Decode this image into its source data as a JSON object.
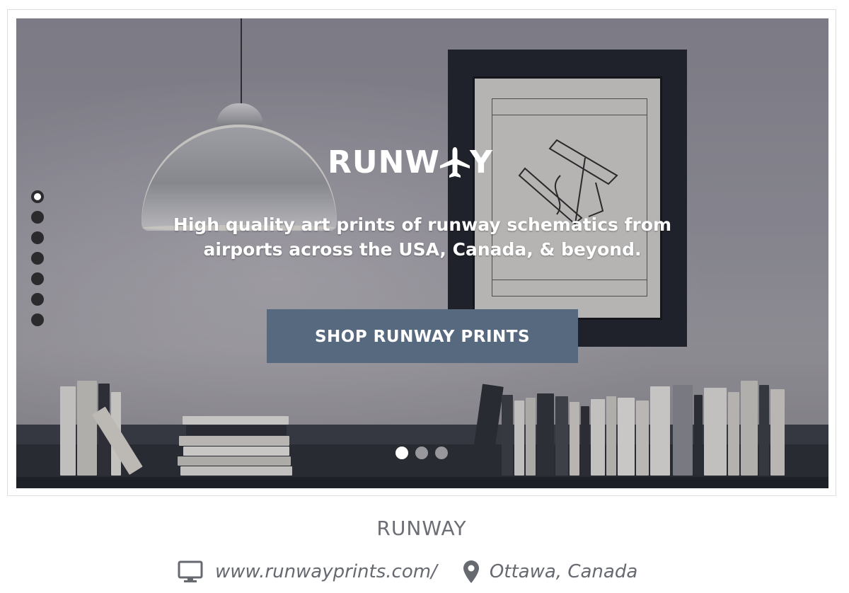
{
  "hero": {
    "logo_text": "RUNW",
    "logo_tail": "Y",
    "tagline": "High quality art prints of runway schematics from airports across the USA, Canada, & beyond.",
    "cta_label": "SHOP RUNWAY PRINTS",
    "vertical_slides": 7,
    "vertical_active": 0,
    "carousel_slides": 3,
    "carousel_active": 0
  },
  "listing": {
    "title": "RUNWAY",
    "url": "www.runwayprints.com/",
    "location": "Ottawa, Canada"
  },
  "icons": {
    "monitor": "monitor-icon",
    "pin": "map-pin-icon",
    "plane": "airplane-icon"
  },
  "colors": {
    "cta_bg": "#56697f",
    "text_muted": "#6b6e74",
    "dot_dark": "#2b2b2e"
  }
}
